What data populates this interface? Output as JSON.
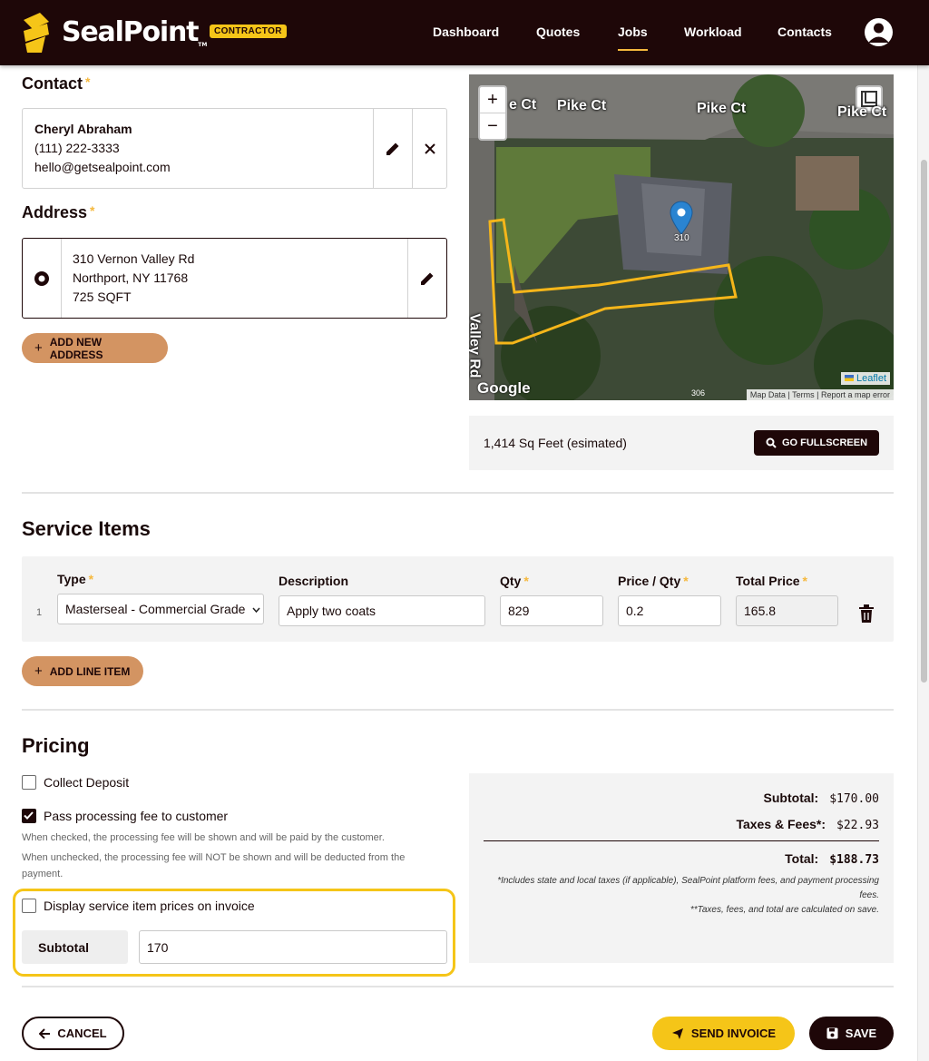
{
  "nav": {
    "brand": "SealPoint",
    "tm": "TM",
    "badge": "CONTRACTOR",
    "links": [
      "Dashboard",
      "Quotes",
      "Jobs",
      "Workload",
      "Contacts"
    ],
    "active": "Jobs"
  },
  "contact": {
    "heading": "Contact",
    "required": "*",
    "name": "Cheryl Abraham",
    "phone": "(111) 222-3333",
    "email": "hello@getsealpoint.com"
  },
  "address": {
    "heading": "Address",
    "required": "*",
    "line1": "310 Vernon Valley Rd",
    "line2": "Northport, NY 11768",
    "line3": "725 SQFT",
    "add_label": "ADD NEW ADDRESS"
  },
  "map": {
    "zoom_in": "+",
    "zoom_out": "−",
    "streets": [
      "e Ct",
      "Pike Ct",
      "Pike Ct",
      "Pike Ct",
      "Valley Rd"
    ],
    "pin_label": "310",
    "google": "Google",
    "leaflet": "Leaflet",
    "attr_num": "306",
    "attr": [
      "Map Data",
      "Terms",
      "Report a map error"
    ],
    "area": "1,414 Sq Feet (esimated)",
    "fullscreen": "GO FULLSCREEN"
  },
  "service": {
    "heading": "Service Items",
    "cols": [
      "Type",
      "Description",
      "Qty",
      "Price / Qty",
      "Total Price"
    ],
    "row": {
      "num": "1",
      "type": "Masterseal - Commercial Grade",
      "desc": "Apply two coats",
      "qty": "829",
      "price": "0.2",
      "total": "165.8"
    },
    "add_label": "ADD LINE ITEM"
  },
  "pricing": {
    "heading": "Pricing",
    "deposit": "Collect Deposit",
    "passfee": "Pass processing fee to customer",
    "hint1": "When checked, the processing fee will be shown and will be paid by the customer.",
    "hint2": "When unchecked, the processing fee will NOT be shown and will be deducted from the payment.",
    "display": "Display service item prices on invoice",
    "subtotal_label": "Subtotal",
    "subtotal_value": "170"
  },
  "summary": {
    "subtotal_label": "Subtotal:",
    "subtotal": "$170.00",
    "taxes_label": "Taxes & Fees*:",
    "taxes": "$22.93",
    "total_label": "Total:",
    "total": "$188.73",
    "note1": "*Includes state and local taxes (if applicable), SealPoint platform fees, and payment processing fees.",
    "note2": "**Taxes, fees, and total are calculated on save."
  },
  "actions": {
    "cancel": "CANCEL",
    "send": "SEND INVOICE",
    "save": "SAVE"
  },
  "colors": {
    "brand_dark": "#1e0708",
    "accent_yellow": "#f5c518",
    "accent_tan": "#d39462"
  }
}
